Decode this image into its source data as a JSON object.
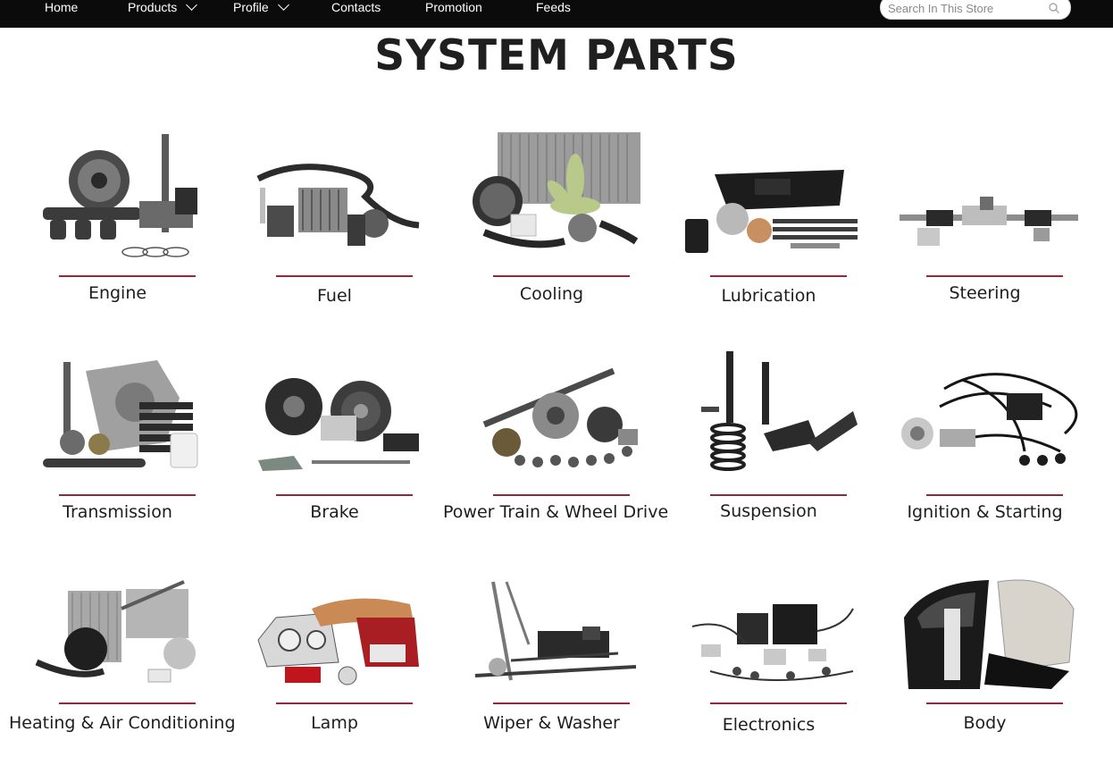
{
  "nav": {
    "items": [
      {
        "label": "Home",
        "has_dropdown": false
      },
      {
        "label": "Products",
        "has_dropdown": true
      },
      {
        "label": "Profile",
        "has_dropdown": true
      },
      {
        "label": "Contacts",
        "has_dropdown": false
      },
      {
        "label": "Promotion",
        "has_dropdown": false
      },
      {
        "label": "Feeds",
        "has_dropdown": false
      }
    ],
    "search_placeholder": "Search In This Store",
    "search_icon": "search-icon",
    "dropdown_icon": "chevron-down-icon"
  },
  "page": {
    "title": "SYSTEM PARTS"
  },
  "colors": {
    "nav_bg": "#0b0b0b",
    "accent_rule": "#8e2a3b",
    "title": "#1f1f1f"
  },
  "categories": [
    {
      "label": "Engine",
      "icon": "engine-parts-image"
    },
    {
      "label": "Fuel",
      "icon": "fuel-system-image"
    },
    {
      "label": "Cooling",
      "icon": "cooling-system-image"
    },
    {
      "label": "Lubrication",
      "icon": "lubrication-system-image"
    },
    {
      "label": "Steering",
      "icon": "steering-system-image"
    },
    {
      "label": "Transmission",
      "icon": "transmission-image"
    },
    {
      "label": "Brake",
      "icon": "brake-system-image"
    },
    {
      "label": "Power Train & Wheel Drive",
      "icon": "power-train-image"
    },
    {
      "label": "Suspension",
      "icon": "suspension-image"
    },
    {
      "label": "Ignition & Starting",
      "icon": "ignition-starting-image"
    },
    {
      "label": "Heating & Air Conditioning",
      "icon": "heating-ac-image"
    },
    {
      "label": "Lamp",
      "icon": "lamp-image"
    },
    {
      "label": "Wiper & Washer",
      "icon": "wiper-washer-image"
    },
    {
      "label": "Electronics",
      "icon": "electronics-image"
    },
    {
      "label": "Body",
      "icon": "body-parts-image"
    }
  ]
}
